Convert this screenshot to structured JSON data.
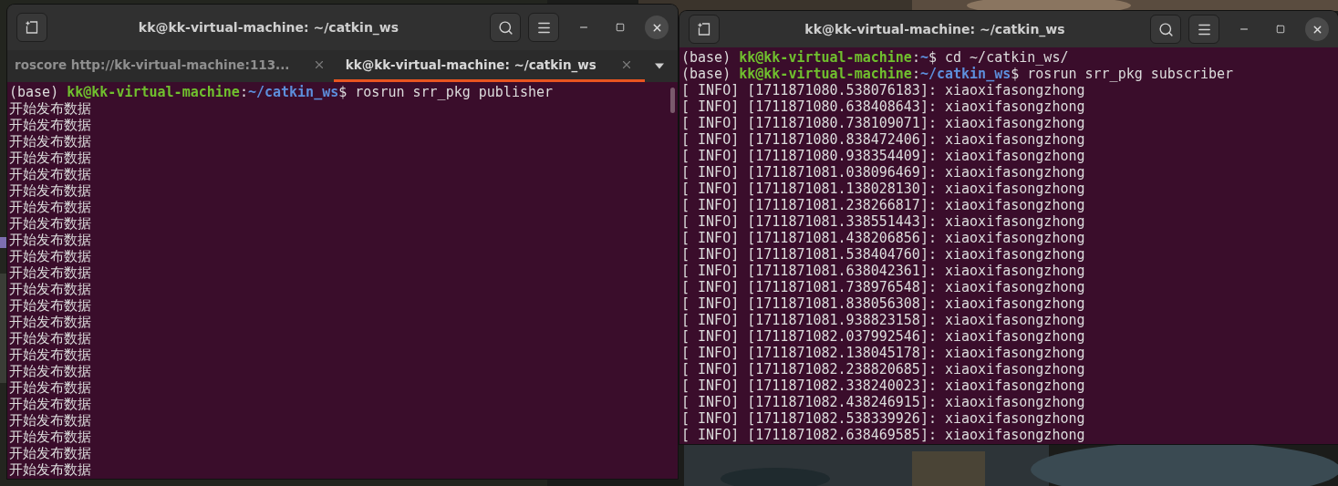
{
  "windows": [
    {
      "title": "kk@kk-virtual-machine: ~/catkin_ws",
      "tabs": [
        {
          "label": "roscore http://kk-virtual-machine:113...",
          "selected": false
        },
        {
          "label": "kk@kk-virtual-machine: ~/catkin_ws",
          "selected": true
        }
      ],
      "lines": [
        {
          "kind": "prompt",
          "env": "(base)",
          "user_host": "kk@kk-virtual-machine",
          "sep": ":",
          "path": "~/catkin_ws",
          "command": "$ rosrun srr_pkg publisher"
        },
        {
          "kind": "output",
          "text": "开始发布数据"
        },
        {
          "kind": "output",
          "text": "开始发布数据"
        },
        {
          "kind": "output",
          "text": "开始发布数据"
        },
        {
          "kind": "output",
          "text": "开始发布数据"
        },
        {
          "kind": "output",
          "text": "开始发布数据"
        },
        {
          "kind": "output",
          "text": "开始发布数据"
        },
        {
          "kind": "output",
          "text": "开始发布数据"
        },
        {
          "kind": "output",
          "text": "开始发布数据"
        },
        {
          "kind": "output",
          "text": "开始发布数据"
        },
        {
          "kind": "output",
          "text": "开始发布数据"
        },
        {
          "kind": "output",
          "text": "开始发布数据"
        },
        {
          "kind": "output",
          "text": "开始发布数据"
        },
        {
          "kind": "output",
          "text": "开始发布数据"
        },
        {
          "kind": "output",
          "text": "开始发布数据"
        },
        {
          "kind": "output",
          "text": "开始发布数据"
        },
        {
          "kind": "output",
          "text": "开始发布数据"
        },
        {
          "kind": "output",
          "text": "开始发布数据"
        },
        {
          "kind": "output",
          "text": "开始发布数据"
        },
        {
          "kind": "output",
          "text": "开始发布数据"
        },
        {
          "kind": "output",
          "text": "开始发布数据"
        },
        {
          "kind": "output",
          "text": "开始发布数据"
        },
        {
          "kind": "output",
          "text": "开始发布数据"
        },
        {
          "kind": "output",
          "text": "开始发布数据"
        }
      ]
    },
    {
      "title": "kk@kk-virtual-machine: ~/catkin_ws",
      "lines": [
        {
          "kind": "prompt",
          "env": "(base)",
          "user_host": "kk@kk-virtual-machine",
          "sep": ":",
          "path": "~",
          "command": "$ cd ~/catkin_ws/"
        },
        {
          "kind": "prompt",
          "env": "(base)",
          "user_host": "kk@kk-virtual-machine",
          "sep": ":",
          "path": "~/catkin_ws",
          "command": "$ rosrun srr_pkg subscriber"
        },
        {
          "kind": "output",
          "text": "[ INFO] [1711871080.538076183]: xiaoxifasongzhong"
        },
        {
          "kind": "output",
          "text": "[ INFO] [1711871080.638408643]: xiaoxifasongzhong"
        },
        {
          "kind": "output",
          "text": "[ INFO] [1711871080.738109071]: xiaoxifasongzhong"
        },
        {
          "kind": "output",
          "text": "[ INFO] [1711871080.838472406]: xiaoxifasongzhong"
        },
        {
          "kind": "output",
          "text": "[ INFO] [1711871080.938354409]: xiaoxifasongzhong"
        },
        {
          "kind": "output",
          "text": "[ INFO] [1711871081.038096469]: xiaoxifasongzhong"
        },
        {
          "kind": "output",
          "text": "[ INFO] [1711871081.138028130]: xiaoxifasongzhong"
        },
        {
          "kind": "output",
          "text": "[ INFO] [1711871081.238266817]: xiaoxifasongzhong"
        },
        {
          "kind": "output",
          "text": "[ INFO] [1711871081.338551443]: xiaoxifasongzhong"
        },
        {
          "kind": "output",
          "text": "[ INFO] [1711871081.438206856]: xiaoxifasongzhong"
        },
        {
          "kind": "output",
          "text": "[ INFO] [1711871081.538404760]: xiaoxifasongzhong"
        },
        {
          "kind": "output",
          "text": "[ INFO] [1711871081.638042361]: xiaoxifasongzhong"
        },
        {
          "kind": "output",
          "text": "[ INFO] [1711871081.738976548]: xiaoxifasongzhong"
        },
        {
          "kind": "output",
          "text": "[ INFO] [1711871081.838056308]: xiaoxifasongzhong"
        },
        {
          "kind": "output",
          "text": "[ INFO] [1711871081.938823158]: xiaoxifasongzhong"
        },
        {
          "kind": "output",
          "text": "[ INFO] [1711871082.037992546]: xiaoxifasongzhong"
        },
        {
          "kind": "output",
          "text": "[ INFO] [1711871082.138045178]: xiaoxifasongzhong"
        },
        {
          "kind": "output",
          "text": "[ INFO] [1711871082.238820685]: xiaoxifasongzhong"
        },
        {
          "kind": "output",
          "text": "[ INFO] [1711871082.338240023]: xiaoxifasongzhong"
        },
        {
          "kind": "output",
          "text": "[ INFO] [1711871082.438246915]: xiaoxifasongzhong"
        },
        {
          "kind": "output",
          "text": "[ INFO] [1711871082.538339926]: xiaoxifasongzhong"
        },
        {
          "kind": "output",
          "text": "[ INFO] [1711871082.638469585]: xiaoxifasongzhong"
        }
      ]
    }
  ]
}
